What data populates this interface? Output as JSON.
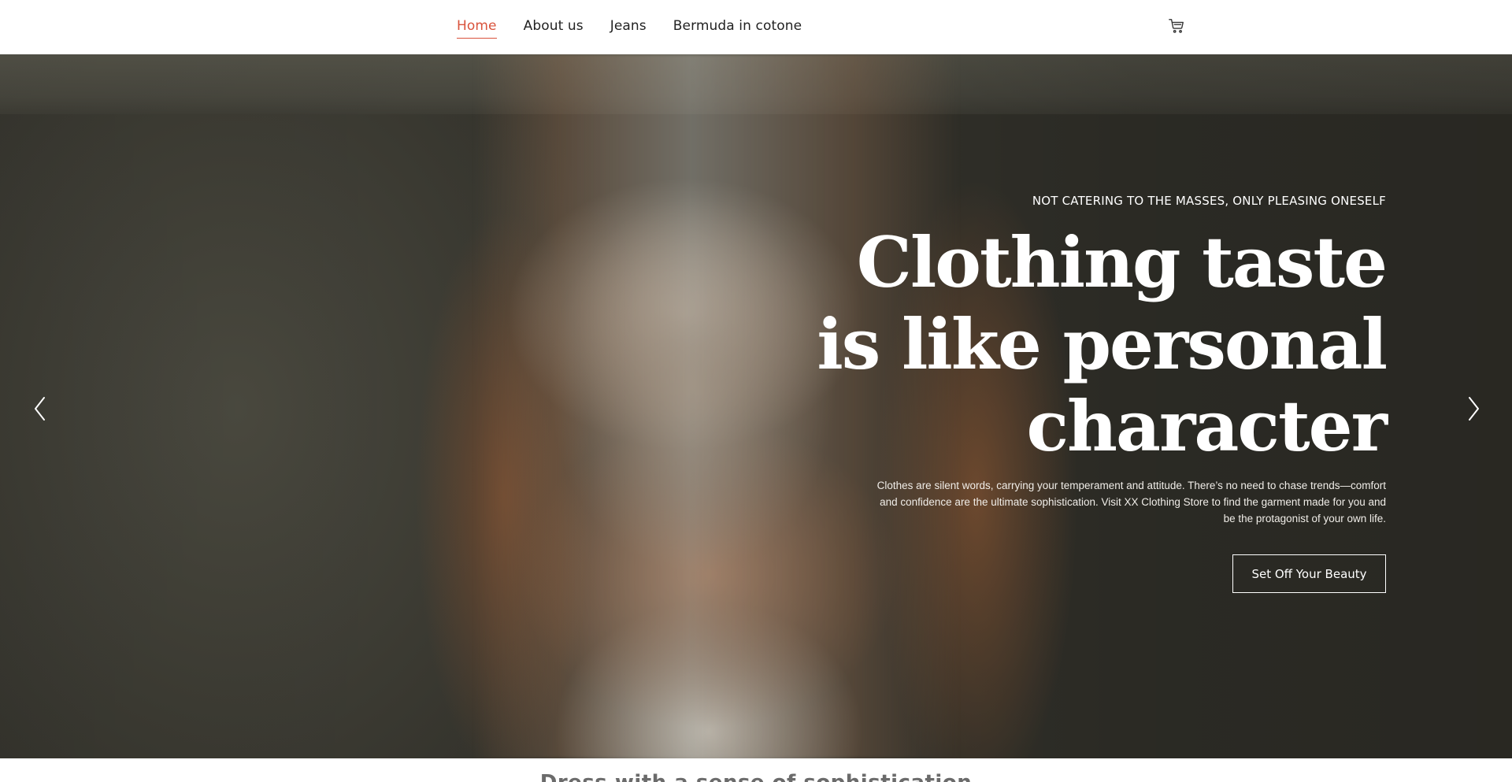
{
  "nav": {
    "items": [
      {
        "label": "Home",
        "active": true
      },
      {
        "label": "About us",
        "active": false
      },
      {
        "label": "Jeans",
        "active": false
      },
      {
        "label": "Bermuda in cotone",
        "active": false
      }
    ],
    "cart_icon": "cart-icon",
    "active_color": "#d9533c"
  },
  "hero": {
    "eyebrow": "NOT CATERING TO THE MASSES, ONLY PLEASING ONESELF",
    "headline_lines": [
      "Clothing taste",
      "is like personal",
      "character"
    ],
    "description": "Clothes are silent words, carrying your temperament and attitude. There’s no need to chase trends—comfort and confidence are the ultimate sophistication. Visit XX Clothing Store to find the garment made for you and be the protagonist of your own life.",
    "cta_label": "Set Off Your Beauty",
    "prev_icon": "chevron-left-icon",
    "next_icon": "chevron-right-icon"
  },
  "section": {
    "title": "Dress with a sense of sophistication"
  }
}
